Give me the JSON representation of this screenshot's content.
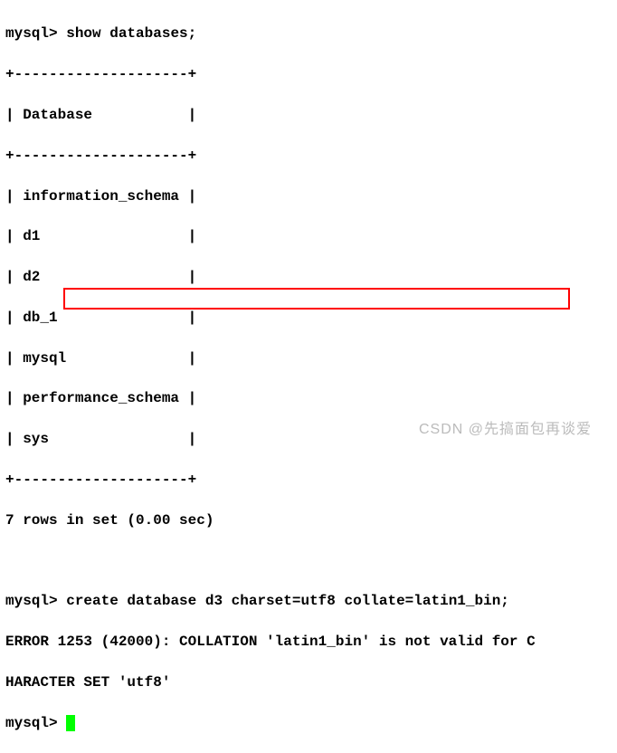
{
  "terminal": {
    "prompt": "mysql>",
    "cmd1": "show databases;",
    "border_line": "+--------------------+",
    "header_line": "| Database           |",
    "rows": [
      "| information_schema |",
      "| d1                 |",
      "| d2                 |",
      "| db_1               |",
      "| mysql              |",
      "| performance_schema |",
      "| sys                |"
    ],
    "result_summary": "7 rows in set (0.00 sec)",
    "cmd2": "create database d3 charset=utf8 collate=latin1_bin;",
    "error_line1": "ERROR 1253 (42000): COLLATION 'latin1_bin' is not valid for C",
    "error_line2": "HARACTER SET 'utf8'"
  },
  "watermark": "CSDN @先搞面包再谈爱"
}
